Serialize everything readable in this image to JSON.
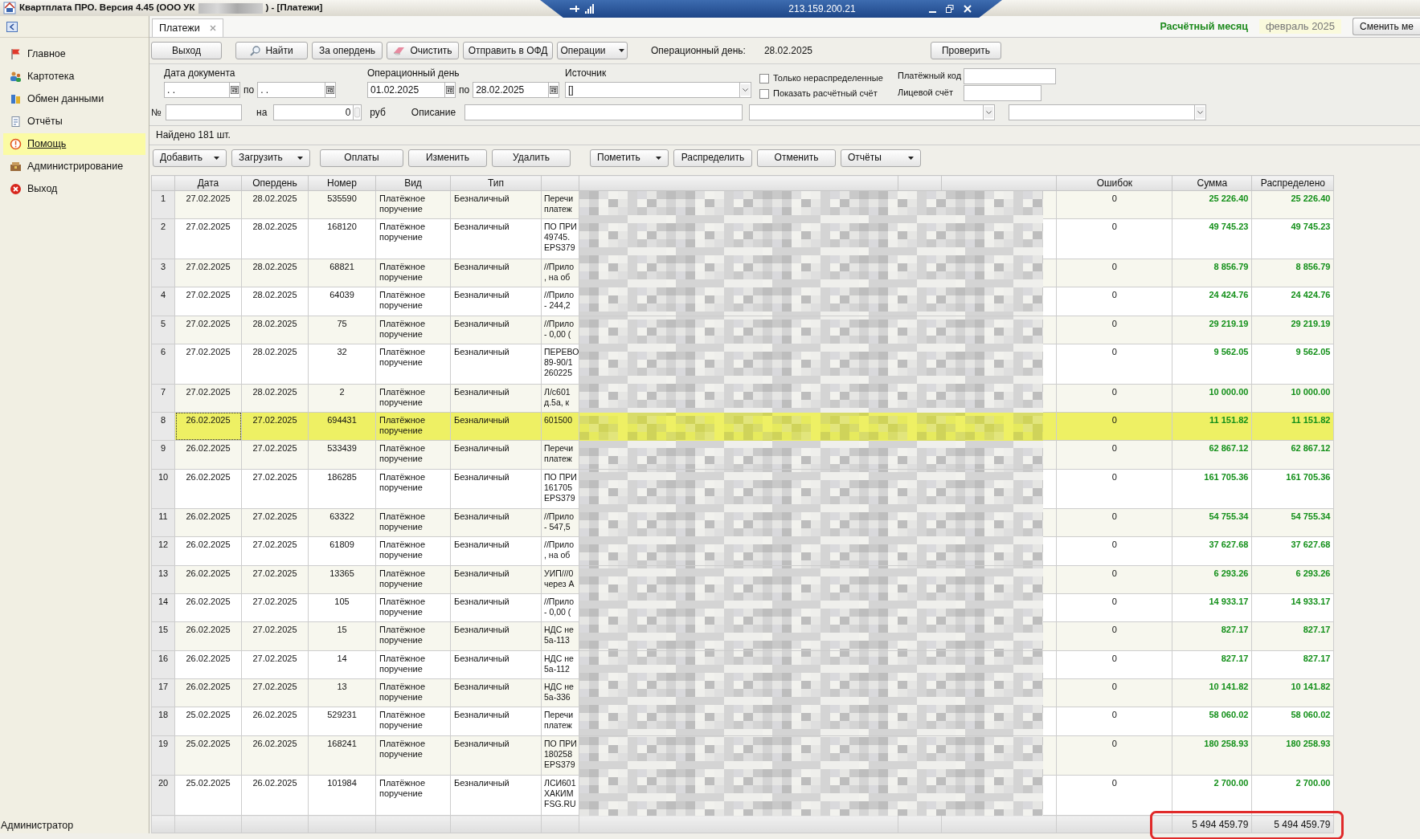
{
  "title_bar": {
    "title": "Квартплата ПРО.  Версия 4.45 (ООО УК",
    "title_suffix": ") - [Платежи]"
  },
  "remote_bar": {
    "address": "213.159.200.21"
  },
  "sidebar": {
    "items": [
      {
        "label": "Главное",
        "kind": "flag",
        "selected": false
      },
      {
        "label": "Картотека",
        "kind": "people",
        "selected": false
      },
      {
        "label": "Обмен данными",
        "kind": "exchange",
        "selected": false
      },
      {
        "label": "Отчёты",
        "kind": "report",
        "selected": false
      },
      {
        "label": "Помощь",
        "kind": "help",
        "selected": true
      },
      {
        "label": "Администрирование",
        "kind": "admin",
        "selected": false
      },
      {
        "label": "Выход",
        "kind": "exit",
        "selected": false
      }
    ],
    "status": "Администратор"
  },
  "tabs": [
    {
      "label": "Платежи",
      "selected": true
    }
  ],
  "period": {
    "label": "Расчётный месяц",
    "value": "февраль 2025",
    "button": "Сменить ме"
  },
  "toolbar": {
    "buttons": [
      {
        "label": "Выход",
        "kind": "plain"
      },
      {
        "label": "Найти",
        "kind": "search"
      },
      {
        "label": "За опердень",
        "kind": "plain"
      },
      {
        "label": "Очистить",
        "kind": "eraser"
      },
      {
        "label": "Отправить в ОФД",
        "kind": "plain"
      },
      {
        "label": "Операции",
        "kind": "dropdown"
      }
    ],
    "op_day_label": "Операционный день:",
    "op_day_value": "28.02.2025",
    "check_button": "Проверить"
  },
  "filters": {
    "doc_date_label": "Дата документа",
    "doc_date_from": ". .",
    "doc_date_to": ". .",
    "doc_date_to_label": "по",
    "op_day_label": "Операционный день",
    "op_day_from": "01.02.2025",
    "op_day_to_label": "по",
    "op_day_to": "28.02.2025",
    "source_label": "Источник",
    "source_value": "[]",
    "checkboxes": [
      {
        "label": "Только нераспределенные",
        "checked": false
      },
      {
        "label": "Показать расчётный счёт",
        "checked": false
      }
    ],
    "pay_code_label": "Платёжный код",
    "account_label": "Лицевой счёт",
    "number_label": "№",
    "amount_label": "на",
    "amount_value": "0",
    "currency": "руб",
    "description_label": "Описание"
  },
  "found": "Найдено 181 шт.",
  "actions": [
    {
      "label": "Добавить",
      "dropdown": true
    },
    {
      "label": "Загрузить",
      "dropdown": true
    },
    {
      "label": "Оплаты",
      "dropdown": false
    },
    {
      "label": "Изменить",
      "dropdown": false
    },
    {
      "label": "Удалить",
      "dropdown": false
    },
    {
      "label": "Пометить",
      "dropdown": true
    },
    {
      "label": "Распределить",
      "dropdown": false
    },
    {
      "label": "Отменить",
      "dropdown": false
    },
    {
      "label": "Отчёты",
      "dropdown": true
    }
  ],
  "table": {
    "columns": [
      "Дата",
      "Опердень",
      "Номер",
      "Вид",
      "Тип",
      "Ошибок",
      "Сумма",
      "Распределено"
    ],
    "rows": [
      {
        "n": "1",
        "date": "27.02.2025",
        "op_day": "28.02.2025",
        "number": "535590",
        "doc": "Платёжное поручение",
        "pay_type": "Безналичный",
        "description": "Перечи\nплатеж",
        "errors": "0",
        "sum": "25 226.40",
        "distributed": "25 226.40",
        "selected": false
      },
      {
        "n": "2",
        "date": "27.02.2025",
        "op_day": "28.02.2025",
        "number": "168120",
        "doc": "Платёжное поручение",
        "pay_type": "Безналичный",
        "description": "ПО ПРИ\n49745.\nEPS379",
        "errors": "0",
        "sum": "49 745.23",
        "distributed": "49 745.23",
        "selected": false
      },
      {
        "n": "3",
        "date": "27.02.2025",
        "op_day": "28.02.2025",
        "number": "68821",
        "doc": "Платёжное поручение",
        "pay_type": "Безналичный",
        "description": "//Прило\n, на об",
        "errors": "0",
        "sum": "8 856.79",
        "distributed": "8 856.79",
        "selected": false
      },
      {
        "n": "4",
        "date": "27.02.2025",
        "op_day": "28.02.2025",
        "number": "64039",
        "doc": "Платёжное поручение",
        "pay_type": "Безналичный",
        "description": "//Прило\n- 244,2",
        "errors": "0",
        "sum": "24 424.76",
        "distributed": "24 424.76",
        "selected": false
      },
      {
        "n": "5",
        "date": "27.02.2025",
        "op_day": "28.02.2025",
        "number": "75",
        "doc": "Платёжное поручение",
        "pay_type": "Безналичный",
        "description": "//Прило\n- 0,00 (",
        "errors": "0",
        "sum": "29 219.19",
        "distributed": "29 219.19",
        "selected": false
      },
      {
        "n": "6",
        "date": "27.02.2025",
        "op_day": "28.02.2025",
        "number": "32",
        "doc": "Платёжное поручение",
        "pay_type": "Безналичный",
        "description": "ПЕРЕВО\n89-90/1\n260225",
        "errors": "0",
        "sum": "9 562.05",
        "distributed": "9 562.05",
        "selected": false
      },
      {
        "n": "7",
        "date": "27.02.2025",
        "op_day": "28.02.2025",
        "number": "2",
        "doc": "Платёжное поручение",
        "pay_type": "Безналичный",
        "description": "Л/с601\nд.5а, к",
        "errors": "0",
        "sum": "10 000.00",
        "distributed": "10 000.00",
        "selected": false
      },
      {
        "n": "8",
        "date": "26.02.2025",
        "op_day": "27.02.2025",
        "number": "694431",
        "doc": "Платёжное поручение",
        "pay_type": "Безналичный",
        "description": "601500",
        "errors": "0",
        "sum": "11 151.82",
        "distributed": "11 151.82",
        "selected": true
      },
      {
        "n": "9",
        "date": "26.02.2025",
        "op_day": "27.02.2025",
        "number": "533439",
        "doc": "Платёжное поручение",
        "pay_type": "Безналичный",
        "description": "Перечи\nплатеж",
        "errors": "0",
        "sum": "62 867.12",
        "distributed": "62 867.12",
        "selected": false
      },
      {
        "n": "10",
        "date": "26.02.2025",
        "op_day": "27.02.2025",
        "number": "186285",
        "doc": "Платёжное поручение",
        "pay_type": "Безналичный",
        "description": "ПО ПРИ\n161705\nEPS379",
        "errors": "0",
        "sum": "161 705.36",
        "distributed": "161 705.36",
        "selected": false
      },
      {
        "n": "11",
        "date": "26.02.2025",
        "op_day": "27.02.2025",
        "number": "63322",
        "doc": "Платёжное поручение",
        "pay_type": "Безналичный",
        "description": "//Прило\n- 547,5",
        "errors": "0",
        "sum": "54 755.34",
        "distributed": "54 755.34",
        "selected": false
      },
      {
        "n": "12",
        "date": "26.02.2025",
        "op_day": "27.02.2025",
        "number": "61809",
        "doc": "Платёжное поручение",
        "pay_type": "Безналичный",
        "description": "//Прило\n, на об",
        "errors": "0",
        "sum": "37 627.68",
        "distributed": "37 627.68",
        "selected": false
      },
      {
        "n": "13",
        "date": "26.02.2025",
        "op_day": "27.02.2025",
        "number": "13365",
        "doc": "Платёжное поручение",
        "pay_type": "Безналичный",
        "description": "УИП///0\nчерез А",
        "errors": "0",
        "sum": "6 293.26",
        "distributed": "6 293.26",
        "selected": false
      },
      {
        "n": "14",
        "date": "26.02.2025",
        "op_day": "27.02.2025",
        "number": "105",
        "doc": "Платёжное поручение",
        "pay_type": "Безналичный",
        "description": "//Прило\n- 0,00 (",
        "errors": "0",
        "sum": "14 933.17",
        "distributed": "14 933.17",
        "selected": false
      },
      {
        "n": "15",
        "date": "26.02.2025",
        "op_day": "27.02.2025",
        "number": "15",
        "doc": "Платёжное поручение",
        "pay_type": "Безналичный",
        "description": "НДС не\n5а-113",
        "errors": "0",
        "sum": "827.17",
        "distributed": "827.17",
        "selected": false
      },
      {
        "n": "16",
        "date": "26.02.2025",
        "op_day": "27.02.2025",
        "number": "14",
        "doc": "Платёжное поручение",
        "pay_type": "Безналичный",
        "description": "НДС не\n5а-112",
        "errors": "0",
        "sum": "827.17",
        "distributed": "827.17",
        "selected": false
      },
      {
        "n": "17",
        "date": "26.02.2025",
        "op_day": "27.02.2025",
        "number": "13",
        "doc": "Платёжное поручение",
        "pay_type": "Безналичный",
        "description": "НДС не\n5а-336",
        "errors": "0",
        "sum": "10 141.82",
        "distributed": "10 141.82",
        "selected": false
      },
      {
        "n": "18",
        "date": "25.02.2025",
        "op_day": "26.02.2025",
        "number": "529231",
        "doc": "Платёжное поручение",
        "pay_type": "Безналичный",
        "description": "Перечи\nплатеж",
        "errors": "0",
        "sum": "58 060.02",
        "distributed": "58 060.02",
        "selected": false
      },
      {
        "n": "19",
        "date": "25.02.2025",
        "op_day": "26.02.2025",
        "number": "168241",
        "doc": "Платёжное поручение",
        "pay_type": "Безналичный",
        "description": "ПО ПРИ\n180258\nEPS379",
        "errors": "0",
        "sum": "180 258.93",
        "distributed": "180 258.93",
        "selected": false
      },
      {
        "n": "20",
        "date": "25.02.2025",
        "op_day": "26.02.2025",
        "number": "101984",
        "doc": "Платёжное поручение",
        "pay_type": "Безналичный",
        "description": "ЛСИ601\nХАКИМ\nFSG.RU",
        "errors": "0",
        "sum": "2 700.00",
        "distributed": "2 700.00",
        "selected": false
      }
    ],
    "totals": {
      "sum": "5 494 459.79",
      "distributed": "5 494 459.79"
    }
  }
}
